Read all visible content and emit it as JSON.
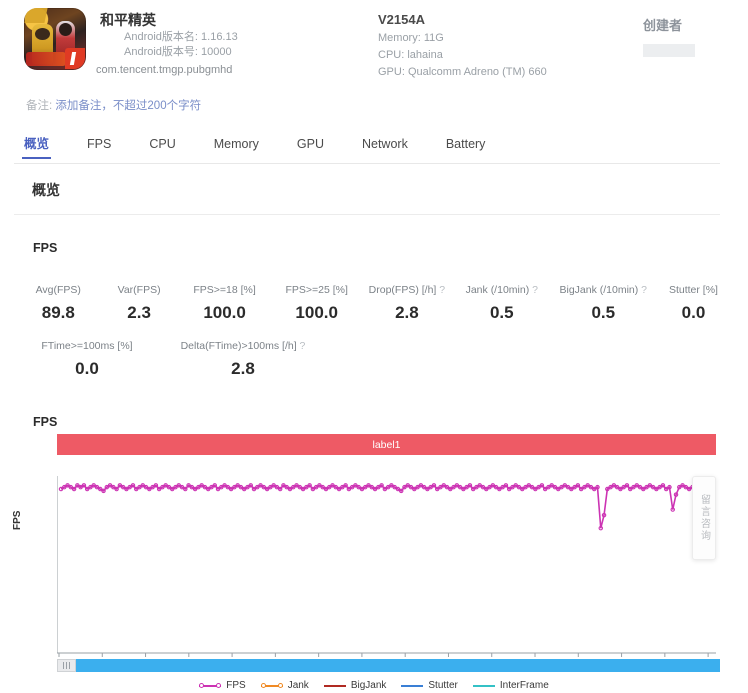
{
  "app": {
    "name": "和平精英",
    "version_name": "Android版本名: 1.16.13",
    "version_code": "Android版本号: 10000",
    "package": "com.tencent.tmgp.pubgmhd",
    "icon": "game-app-icon"
  },
  "device": {
    "model": "V2154A",
    "memory": "Memory: 11G",
    "cpu": "CPU: lahaina",
    "gpu": "GPU: Qualcomm Adreno (TM) 660"
  },
  "creator": {
    "title": "创建者",
    "value": ""
  },
  "note": {
    "label": "备注:",
    "link": "添加备注，不超过200个字符"
  },
  "tabs": [
    {
      "label": "概览",
      "active": true
    },
    {
      "label": "FPS",
      "active": false
    },
    {
      "label": "CPU",
      "active": false
    },
    {
      "label": "Memory",
      "active": false
    },
    {
      "label": "GPU",
      "active": false
    },
    {
      "label": "Network",
      "active": false
    },
    {
      "label": "Battery",
      "active": false
    }
  ],
  "section": {
    "title": "概览"
  },
  "fps_block": {
    "title": "FPS"
  },
  "metrics_row1": [
    {
      "label": "Avg(FPS)",
      "help": "",
      "value": "89.8"
    },
    {
      "label": "Var(FPS)",
      "help": "",
      "value": "2.3"
    },
    {
      "label": "FPS>=18 [%]",
      "help": "",
      "value": "100.0"
    },
    {
      "label": "FPS>=25 [%]",
      "help": "",
      "value": "100.0"
    },
    {
      "label": "Drop(FPS) [/h]",
      "help": "?",
      "value": "2.8"
    },
    {
      "label": "Jank (/10min)",
      "help": "?",
      "value": "0.5"
    },
    {
      "label": "BigJank (/10min)",
      "help": "?",
      "value": "0.5"
    },
    {
      "label": "Stutter [%]",
      "help": "",
      "value": "0.0"
    }
  ],
  "metrics_row2": [
    {
      "label": "FTime>=100ms [%]",
      "help": "",
      "value": "0.0"
    },
    {
      "label": "Delta(FTime)>100ms [/h]",
      "help": "?",
      "value": "2.8"
    }
  ],
  "chart_block": {
    "title": "FPS",
    "band_label": "label1",
    "band_color": "#ee5a65"
  },
  "side_tab": {
    "label": "留言咨询"
  },
  "slider": {
    "grip": "drag-grip",
    "track_color": "#3bafee"
  },
  "chart_data": {
    "type": "line",
    "title": "FPS",
    "xlabel": "",
    "ylabel": "FPS",
    "ylim": [
      0,
      95
    ],
    "yticks": [
      0,
      9,
      18,
      27,
      36,
      46,
      55,
      64,
      73,
      82,
      91
    ],
    "xticks": [
      "00:00",
      "01:05",
      "02:10",
      "03:15",
      "04:20",
      "05:25",
      "06:30",
      "07:35",
      "08:40",
      "09:45",
      "10:50",
      "11:55",
      "13:00",
      "14:05",
      "15:10",
      "16:15"
    ],
    "xlim_minutes": [
      0,
      1015
    ],
    "grid": false,
    "legend_position": "bottom",
    "annotation_band": "label1",
    "series": [
      {
        "name": "FPS",
        "color": "#cc33b3",
        "marker": "circle",
        "avg": 89.8,
        "values": [
          88,
          89,
          90,
          89,
          88,
          90,
          89,
          90,
          88,
          89,
          90,
          89,
          88,
          87,
          89,
          90,
          89,
          88,
          90,
          89,
          88,
          89,
          90,
          88,
          89,
          90,
          89,
          88,
          89,
          90,
          88,
          89,
          90,
          89,
          88,
          89,
          90,
          89,
          88,
          90,
          89,
          88,
          89,
          90,
          89,
          88,
          89,
          90,
          88,
          89,
          90,
          89,
          88,
          89,
          90,
          89,
          88,
          89,
          90,
          88,
          89,
          90,
          89,
          88,
          89,
          90,
          89,
          88,
          90,
          89,
          88,
          89,
          90,
          89,
          88,
          89,
          90,
          88,
          89,
          90,
          89,
          88,
          89,
          90,
          89,
          88,
          89,
          90,
          88,
          89,
          90,
          89,
          88,
          89,
          90,
          89,
          88,
          89,
          90,
          88,
          89,
          90,
          89,
          88,
          87,
          89,
          90,
          89,
          88,
          89,
          90,
          89,
          88,
          89,
          90,
          88,
          89,
          90,
          89,
          88,
          89,
          90,
          89,
          88,
          89,
          90,
          88,
          89,
          90,
          89,
          88,
          89,
          90,
          89,
          88,
          89,
          90,
          88,
          89,
          90,
          89,
          88,
          89,
          90,
          89,
          88,
          89,
          90,
          88,
          89,
          90,
          89,
          88,
          89,
          90,
          89,
          88,
          89,
          90,
          88,
          89,
          90,
          89,
          88,
          89,
          67,
          74,
          88,
          89,
          90,
          89,
          88,
          89,
          90,
          88,
          89,
          90,
          89,
          88,
          89,
          90,
          89,
          88,
          89,
          90,
          88,
          89,
          77,
          85,
          89,
          90,
          89,
          88,
          89,
          90,
          89,
          88,
          89,
          90,
          88
        ]
      },
      {
        "name": "Jank",
        "color": "#f08a24",
        "marker": "circle",
        "values": []
      },
      {
        "name": "BigJank",
        "color": "#b02a22",
        "marker": "none",
        "values": []
      },
      {
        "name": "Stutter",
        "color": "#3a7fd5",
        "marker": "none",
        "values": []
      },
      {
        "name": "InterFrame",
        "color": "#34c1c6",
        "marker": "none",
        "values": []
      }
    ]
  },
  "legend": [
    {
      "name": "FPS",
      "color": "#cc33b3",
      "marker": true
    },
    {
      "name": "Jank",
      "color": "#f08a24",
      "marker": true
    },
    {
      "name": "BigJank",
      "color": "#b02a22",
      "marker": false
    },
    {
      "name": "Stutter",
      "color": "#3a7fd5",
      "marker": false
    },
    {
      "name": "InterFrame",
      "color": "#34c1c6",
      "marker": false
    }
  ]
}
